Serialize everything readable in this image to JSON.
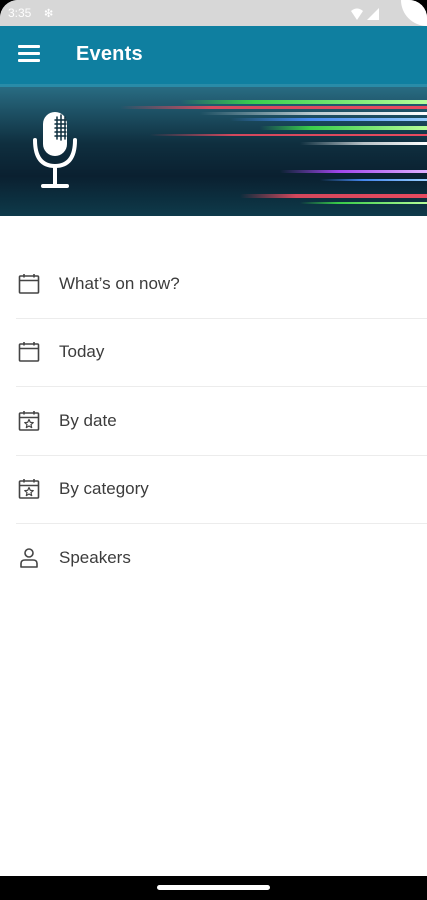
{
  "status_bar": {
    "time": "3:35",
    "indicator_icon": "sync-icon",
    "wifi_icon": "wifi-icon",
    "signal_icon": "signal-icon"
  },
  "app_bar": {
    "title": "Events",
    "menu_icon": "hamburger-menu-icon"
  },
  "hero": {
    "image": "microphone-banner",
    "accent_colors": [
      "#e84a5f",
      "#3ddc4a",
      "#4a90ff",
      "#b04aff"
    ]
  },
  "menu": {
    "items": [
      {
        "label": "What’s on now?",
        "icon": "calendar-icon"
      },
      {
        "label": "Today",
        "icon": "calendar-icon"
      },
      {
        "label": "By date",
        "icon": "calendar-star-icon"
      },
      {
        "label": "By category",
        "icon": "calendar-star-icon"
      },
      {
        "label": "Speakers",
        "icon": "person-icon"
      }
    ]
  },
  "colors": {
    "app_bar": "#0f7fa0",
    "text": "#3c3c3c",
    "divider": "#ececec"
  }
}
